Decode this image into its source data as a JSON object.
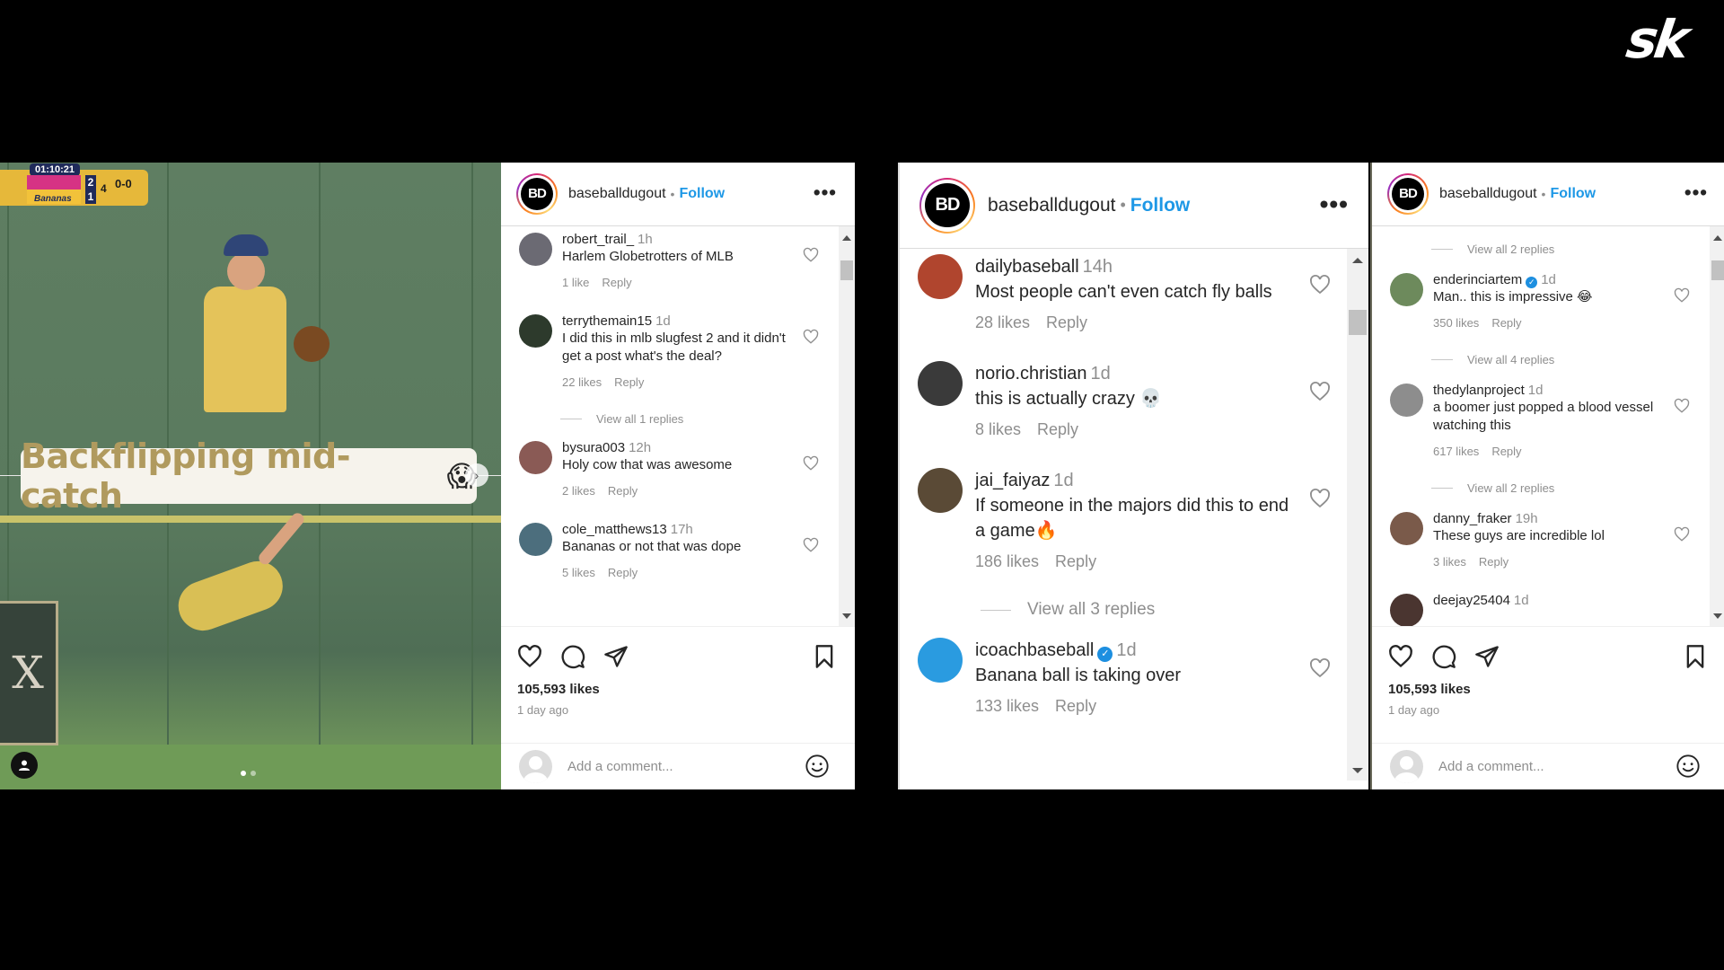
{
  "brand": {
    "logo_text": "sk"
  },
  "media": {
    "scoreboard": {
      "clock": "01:10:21",
      "team_a_score": "2",
      "team_b_score": "1",
      "inning": "4",
      "count": "0-0",
      "team_b_name": "Bananas"
    },
    "sign_text": "X",
    "caption": {
      "text": "Backflipping mid-catch",
      "emoji": "😱"
    },
    "carousel": {
      "current": 1,
      "total": 2
    },
    "icons": {
      "next": "chevron-right-icon",
      "user_tag": "user-icon"
    }
  },
  "colors": {
    "follow": "#1e98e6",
    "caption_text": "#b09a5e",
    "verified": "#1d8fe0"
  },
  "panels": [
    {
      "header": {
        "username": "baseballdugout",
        "separator": "•",
        "follow_label": "Follow",
        "more_label": "•••",
        "avatar_text": "BD"
      },
      "comments": [
        {
          "type": "comment",
          "user": "robert_trail_",
          "time": "1h",
          "verified": false,
          "text": "Harlem Globetrotters of MLB",
          "likes": "1 like",
          "reply": "Reply",
          "avatar_color": "#6b6a73"
        },
        {
          "type": "comment",
          "user": "terrythemain15",
          "time": "1d",
          "verified": false,
          "text": "I did this in mlb slugfest 2 and it didn't get a post what's the deal?",
          "likes": "22 likes",
          "reply": "Reply",
          "avatar_color": "#2d3a2c"
        },
        {
          "type": "viewall",
          "text": "View all 1 replies"
        },
        {
          "type": "comment",
          "user": "bysura003",
          "time": "12h",
          "verified": false,
          "text": "Holy cow that was awesome",
          "likes": "2 likes",
          "reply": "Reply",
          "avatar_color": "#8a5a55"
        },
        {
          "type": "comment",
          "user": "cole_matthews13",
          "time": "17h",
          "verified": false,
          "text": "Bananas or not that was dope",
          "likes": "5 likes",
          "reply": "Reply",
          "avatar_color": "#4c6e7d"
        }
      ],
      "likes_total": "105,593 likes",
      "posted": "1 day ago",
      "add_comment_placeholder": "Add a comment..."
    },
    {
      "header": {
        "username": "baseballdugout",
        "separator": "•",
        "follow_label": "Follow",
        "more_label": "•••",
        "avatar_text": "BD"
      },
      "comments": [
        {
          "type": "comment",
          "user": "dailybaseball",
          "time": "14h",
          "verified": false,
          "text": "Most people can't even catch fly balls",
          "likes": "28 likes",
          "reply": "Reply",
          "avatar_color": "#b0452e"
        },
        {
          "type": "comment",
          "user": "norio.christian",
          "time": "1d",
          "verified": false,
          "text": "this is actually crazy 💀",
          "likes": "8 likes",
          "reply": "Reply",
          "avatar_color": "#3a3a3a"
        },
        {
          "type": "comment",
          "user": "jai_faiyaz",
          "time": "1d",
          "verified": false,
          "text": "If someone in the majors did this to end a game🔥",
          "likes": "186 likes",
          "reply": "Reply",
          "avatar_color": "#5a4a36"
        },
        {
          "type": "viewall",
          "text": "View all 3 replies"
        },
        {
          "type": "comment",
          "user": "icoachbaseball",
          "time": "1d",
          "verified": true,
          "text": "Banana ball is taking over",
          "likes": "133 likes",
          "reply": "Reply",
          "avatar_color": "#2a9be0"
        }
      ]
    },
    {
      "header": {
        "username": "baseballdugout",
        "separator": "•",
        "follow_label": "Follow",
        "more_label": "•••",
        "avatar_text": "BD"
      },
      "comments": [
        {
          "type": "viewall",
          "text": "View all 2 replies"
        },
        {
          "type": "comment",
          "user": "enderinciartem",
          "time": "1d",
          "verified": true,
          "text": "Man.. this is impressive 😂",
          "likes": "350 likes",
          "reply": "Reply",
          "avatar_color": "#6d8a5c"
        },
        {
          "type": "viewall",
          "text": "View all 4 replies"
        },
        {
          "type": "comment",
          "user": "thedylanproject",
          "time": "1d",
          "verified": false,
          "text": "a boomer just popped a blood vessel watching this",
          "likes": "617 likes",
          "reply": "Reply",
          "avatar_color": "#8d8d8d"
        },
        {
          "type": "viewall",
          "text": "View all 2 replies"
        },
        {
          "type": "comment",
          "user": "danny_fraker",
          "time": "19h",
          "verified": false,
          "text": "These guys are incredible lol",
          "likes": "3 likes",
          "reply": "Reply",
          "avatar_color": "#7a5a4a"
        },
        {
          "type": "comment",
          "user": "deejay25404",
          "time": "1d",
          "verified": false,
          "text": "",
          "likes": "",
          "reply": "",
          "avatar_color": "#4a3530"
        }
      ],
      "likes_total": "105,593 likes",
      "posted": "1 day ago",
      "add_comment_placeholder": "Add a comment..."
    }
  ]
}
